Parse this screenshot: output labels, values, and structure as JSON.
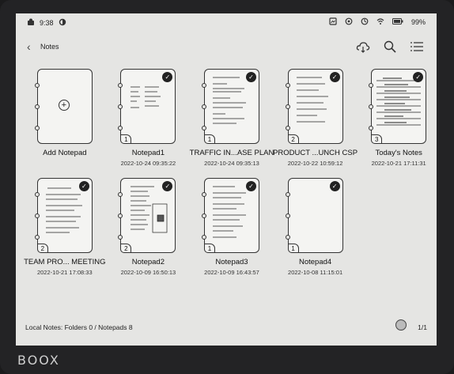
{
  "status": {
    "time": "9:38",
    "battery": "99%"
  },
  "header": {
    "title": "Notes"
  },
  "brand": "BOOX",
  "add_label": "Add Notepad",
  "notes": [
    {
      "name": "Notepad1",
      "date": "2022-10-24 09:35:22",
      "pages": "1"
    },
    {
      "name": "TRAFFIC IN...ASE PLAN",
      "date": "2022-10-24 09:35:13",
      "pages": "1"
    },
    {
      "name": "PRODUCT ...UNCH CSP",
      "date": "2022-10-22 10:59:12",
      "pages": "2"
    },
    {
      "name": "Today's Notes",
      "date": "2022-10-21 17:11:31",
      "pages": "3"
    },
    {
      "name": "TEAM PRO... MEETING",
      "date": "2022-10-21 17:08:33",
      "pages": "2"
    },
    {
      "name": "Notepad2",
      "date": "2022-10-09 16:50:13",
      "pages": "2"
    },
    {
      "name": "Notepad3",
      "date": "2022-10-09 16:43:57",
      "pages": "1"
    },
    {
      "name": "Notepad4",
      "date": "2022-10-08 11:15:01",
      "pages": "1"
    }
  ],
  "footer": {
    "info": "Local Notes: Folders 0 / Notepads 8",
    "page": "1/1"
  }
}
